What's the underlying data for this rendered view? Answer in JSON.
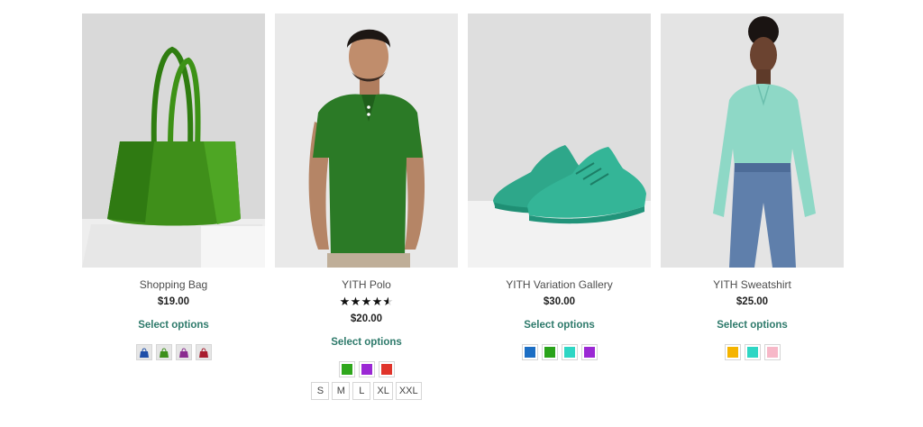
{
  "products": [
    {
      "title": "Shopping Bag",
      "price": "$19.00",
      "select_label": "Select options",
      "image_icon": "green-tote-bag",
      "swatch_type": "thumbnail",
      "swatches": [
        "#1f4fa8",
        "#3d8f1b",
        "#8a2c8f",
        "#a81d2e"
      ]
    },
    {
      "title": "YITH Polo",
      "price": "$20.00",
      "rating": 4.5,
      "rating_max": 5,
      "select_label": "Select options",
      "image_icon": "man-green-polo",
      "swatch_type": "color",
      "swatches": [
        "#2fa71c",
        "#9b28d4",
        "#e0342b"
      ],
      "sizes": [
        "S",
        "M",
        "L",
        "XL",
        "XXL"
      ]
    },
    {
      "title": "YITH Variation Gallery",
      "price": "$30.00",
      "select_label": "Select options",
      "image_icon": "teal-sneakers",
      "swatch_type": "color",
      "swatches": [
        "#1c6ec4",
        "#2aa31a",
        "#2ed6c4",
        "#9b28d4"
      ]
    },
    {
      "title": "YITH Sweatshirt",
      "price": "$25.00",
      "select_label": "Select options",
      "image_icon": "woman-mint-blouse",
      "swatch_type": "color",
      "swatches": [
        "#f5b400",
        "#2ed6c4",
        "#f7b8c8"
      ]
    }
  ]
}
